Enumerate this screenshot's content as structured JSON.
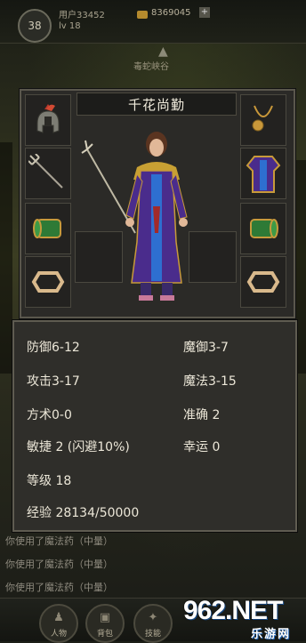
{
  "top_bar": {
    "level_badge": "38",
    "username": "用户33452",
    "level_text": "lv 18",
    "gold": "8369045",
    "add_label": "+",
    "map_name": "毒蛇峡谷"
  },
  "equipment": {
    "character_name": "千花尚勤",
    "left_slots": [
      "helmet-icon",
      "trident-icon",
      "bracer-icon",
      "ring-icon"
    ],
    "right_slots": [
      "necklace-icon",
      "armor-icon",
      "bracer-icon",
      "ring-icon"
    ]
  },
  "stats": {
    "defense": "防御6-12",
    "magic_defense": "魔御3-7",
    "attack": "攻击3-17",
    "magic": "魔法3-15",
    "tao": "方术0-0",
    "accuracy": "准确 2",
    "agility": "敏捷 2 (闪避10%)",
    "luck": "幸运 0",
    "level": "等级 18",
    "exp": "经验 28134/50000"
  },
  "chat_log": [
    "你使用了魔法药（中量）",
    "你使用了魔法药（中量）",
    "你使用了魔法药（中量）"
  ],
  "bottom_nav": [
    {
      "label": "人物",
      "icon": "character-icon"
    },
    {
      "label": "背包",
      "icon": "bag-icon"
    },
    {
      "label": "技能",
      "icon": "skill-icon"
    }
  ],
  "watermark": {
    "site": "962.NET",
    "subtitle": "乐游网"
  },
  "colors": {
    "panel_bg": "#2b2a27",
    "panel_border": "#5a574d",
    "stat_text": "#ece7d8",
    "robe_purple": "#4a2c8c",
    "gold_trim": "#c89a3a"
  }
}
